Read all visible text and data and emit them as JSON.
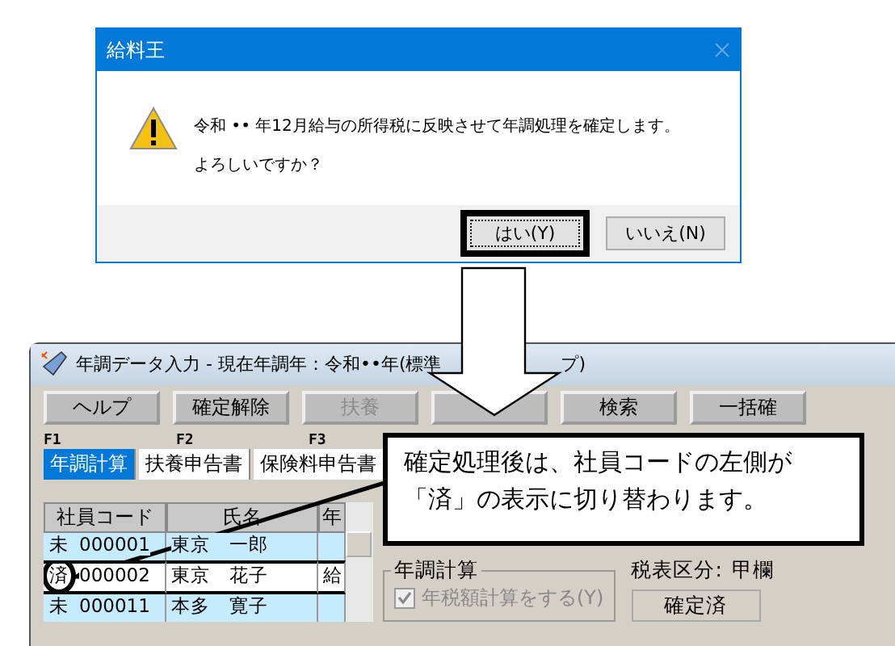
{
  "dialog": {
    "title": "給料王",
    "message_lines": [
      "令和 •• 年12月給与の所得税に反映させて年調処理を確定します。",
      "よろしいですか？"
    ],
    "buttons": [
      {
        "label": "はい(Y)",
        "focused": true
      },
      {
        "label": "いいえ(N)",
        "focused": false
      }
    ]
  },
  "app_window": {
    "title": "年調データ入力 - 現在年調年：令和••年(標準",
    "title_tail": "プ)",
    "toolbar_left": [
      {
        "label": "ヘルプ",
        "disabled": false
      },
      {
        "label": "確定解除",
        "disabled": false
      },
      {
        "label": "扶養",
        "disabled": true
      }
    ],
    "toolbar_right": [
      {
        "label": "検索",
        "disabled": false
      },
      {
        "label": "一括確",
        "disabled": false
      }
    ],
    "function_keys": [
      "F1",
      "F2",
      "F3"
    ],
    "tabs": [
      {
        "label": "年調計算",
        "selected": true
      },
      {
        "label": "扶養申告書",
        "selected": false
      },
      {
        "label": "保険料申告書",
        "selected": false
      }
    ],
    "table": {
      "columns": [
        "社員コード",
        "氏名",
        "年"
      ],
      "rows": [
        {
          "status": "未",
          "code": "000001",
          "name": "東京　一郎",
          "column_3": "",
          "selected": false
        },
        {
          "status": "済",
          "code": "000002",
          "name": "東京　花子",
          "column_3": "給",
          "selected": true
        },
        {
          "status": "未",
          "code": "000011",
          "name": "本多　寛子",
          "column_3": "",
          "selected": false
        }
      ]
    },
    "group": {
      "title": "年調計算",
      "checkbox": {
        "label": "年税額計算をする(Y)",
        "checked": true,
        "disabled": true
      }
    },
    "tax_table": {
      "label": "税表区分:",
      "value": "甲欄"
    },
    "status_button": "確定済"
  },
  "callout": {
    "lines": [
      "確定処理後は、社員コードの左側が",
      "「済」の表示に切り替わります。"
    ]
  }
}
